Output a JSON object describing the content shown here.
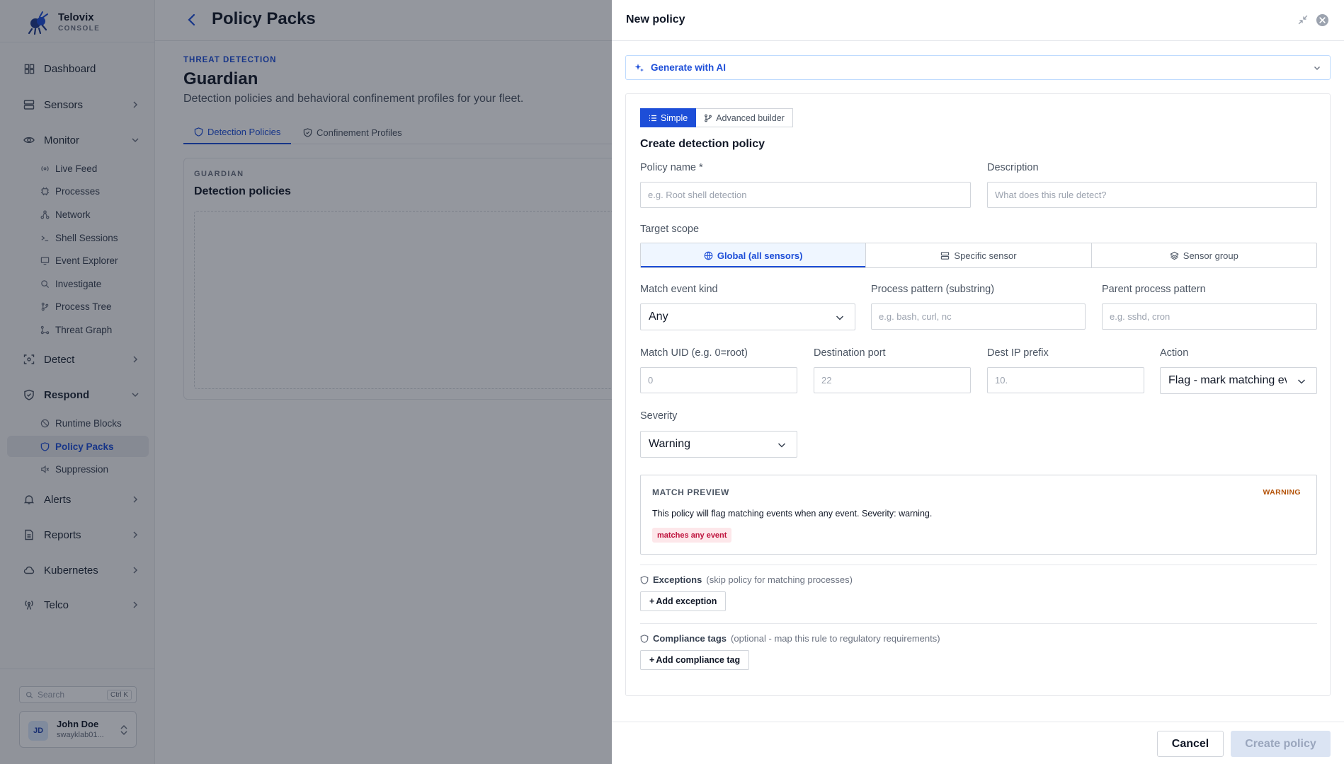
{
  "brand": {
    "name": "Telovix",
    "sub": "CONSOLE"
  },
  "sidebar": {
    "items": [
      {
        "label": "Dashboard",
        "icon": "grid-icon"
      },
      {
        "label": "Sensors",
        "icon": "server-icon"
      },
      {
        "label": "Monitor",
        "icon": "eye-icon"
      },
      {
        "label": "Detect",
        "icon": "scan-icon"
      },
      {
        "label": "Respond",
        "icon": "shield-icon"
      },
      {
        "label": "Alerts",
        "icon": "bell-icon"
      },
      {
        "label": "Reports",
        "icon": "file-icon"
      },
      {
        "label": "Kubernetes",
        "icon": "cloud-icon"
      },
      {
        "label": "Telco",
        "icon": "antenna-icon"
      }
    ],
    "monitor_sub": [
      "Live Feed",
      "Processes",
      "Network",
      "Shell Sessions",
      "Event Explorer",
      "Investigate",
      "Process Tree",
      "Threat Graph"
    ],
    "respond_sub": [
      "Runtime Blocks",
      "Policy Packs",
      "Suppression"
    ],
    "search": {
      "placeholder": "Search",
      "shortcut": "Ctrl K"
    },
    "user": {
      "initials": "JD",
      "name": "John Doe",
      "sub": "swayklab01..."
    }
  },
  "main": {
    "title": "Policy Packs",
    "eyebrow": "THREAT DETECTION",
    "section_title": "Guardian",
    "section_desc": "Detection policies and behavioral confinement profiles for your fleet.",
    "tabs": [
      "Detection Policies",
      "Confinement Profiles"
    ],
    "card": {
      "eyebrow": "GUARDIAN",
      "title": "Detection policies"
    }
  },
  "drawer": {
    "title": "New policy",
    "ai_label": "Generate with AI",
    "modes": [
      "Simple",
      "Advanced builder"
    ],
    "form_title": "Create detection policy",
    "policy_name": {
      "label": "Policy name *",
      "placeholder": "e.g. Root shell detection"
    },
    "description": {
      "label": "Description",
      "placeholder": "What does this rule detect?"
    },
    "target_scope": {
      "label": "Target scope",
      "options": [
        "Global (all sensors)",
        "Specific sensor",
        "Sensor group"
      ],
      "selected": "Global (all sensors)"
    },
    "match_event_kind": {
      "label": "Match event kind",
      "value": "Any"
    },
    "process_pattern": {
      "label": "Process pattern (substring)",
      "placeholder": "e.g. bash, curl, nc"
    },
    "parent_pattern": {
      "label": "Parent process pattern",
      "placeholder": "e.g. sshd, cron"
    },
    "match_uid": {
      "label": "Match UID (e.g. 0=root)",
      "placeholder": "0"
    },
    "dest_port": {
      "label": "Destination port",
      "placeholder": "22"
    },
    "dest_ip": {
      "label": "Dest IP prefix",
      "placeholder": "10."
    },
    "action": {
      "label": "Action",
      "value": "Flag - mark matching events"
    },
    "severity": {
      "label": "Severity",
      "value": "Warning"
    },
    "preview": {
      "title": "MATCH PREVIEW",
      "badge": "WARNING",
      "text": "This policy will flag matching events when any event. Severity: warning.",
      "chip": "matches any event"
    },
    "exceptions": {
      "name": "Exceptions",
      "hint": "(skip policy for matching processes)",
      "button": "Add exception"
    },
    "compliance": {
      "name": "Compliance tags",
      "hint": "(optional - map this rule to regulatory requirements)",
      "button": "Add compliance tag"
    },
    "cancel": "Cancel",
    "create": "Create policy"
  },
  "colors": {
    "accent": "#1d4ed8",
    "warning": "#b45309",
    "chip_bg": "#fde7ea",
    "chip_fg": "#be123c"
  }
}
